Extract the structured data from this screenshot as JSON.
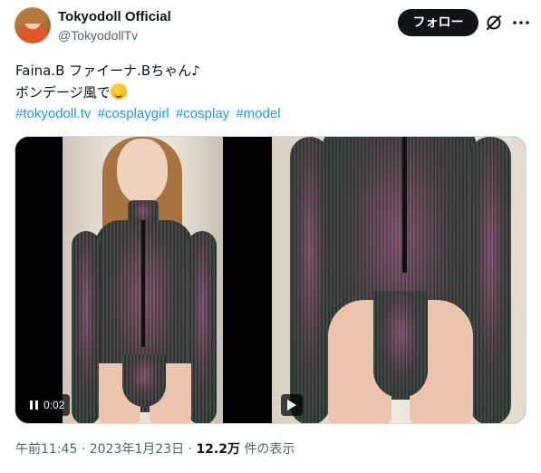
{
  "author": {
    "display_name": "Tokyodoll Official",
    "handle": "@TokyodollTv",
    "avatar": "profile-photo"
  },
  "header": {
    "follow_label": "フォロー",
    "grok_icon": "grok-icon",
    "more_icon": "more-options-icon"
  },
  "tweet": {
    "line1": "Faina.B ファイーナ.Bちゃん♪",
    "line2": "ボンデージ風で",
    "line2_emoji": "winking-face-emoji",
    "hashtags": [
      "#tokyodoll.tv",
      "#cosplaygirl",
      "#cosplay",
      "#model"
    ]
  },
  "media": {
    "video1": {
      "time": "0:02",
      "state": "playing",
      "control_icon": "pause-icon"
    },
    "video2": {
      "state": "paused",
      "control_icon": "play-icon"
    }
  },
  "meta": {
    "time": "午前11:45",
    "sep1": "·",
    "date": "2023年1月23日",
    "sep2": "·",
    "views_count": "12.2万",
    "views_label": "件の表示"
  },
  "colors": {
    "link": "#1d9bf0",
    "text": "#0f1419",
    "secondary": "#536471",
    "follow_bg": "#0f1419"
  }
}
